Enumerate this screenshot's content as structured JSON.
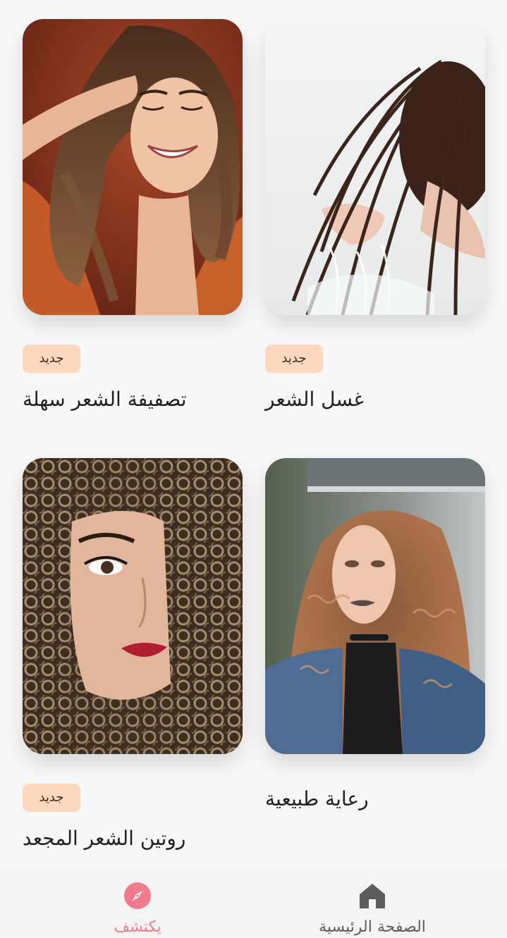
{
  "cards": [
    {
      "badge": "جديد",
      "title": "تصفيفة الشعر سهلة",
      "image": "woman-smiling-hands-in-hair-photo"
    },
    {
      "badge": "جديد",
      "title": "غسل الشعر",
      "image": "washing-hair-under-water-photo"
    },
    {
      "badge": "جديد",
      "title": "روتين الشعر المجعد",
      "image": "curly-hair-portrait-photo"
    },
    {
      "title": "رعاية طبيعية",
      "image": "natural-curly-hair-denim-jacket-photo"
    }
  ],
  "bottom_nav": {
    "explore": {
      "label": "يكتشف",
      "icon": "compass-icon",
      "active": true
    },
    "home": {
      "label": "الصفحة الرئيسية",
      "icon": "home-icon",
      "active": false
    }
  },
  "colors": {
    "background": "#f8f8f9",
    "badge_bg": "#fdd8bd",
    "accent_pink": "#ef7b8c",
    "nav_gray": "#5c5c5c"
  }
}
